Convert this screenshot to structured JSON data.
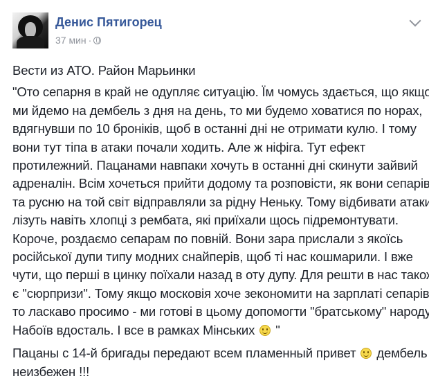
{
  "post": {
    "author": "Денис Пятигорец",
    "time": "37 мин",
    "separator": "·",
    "paragraphs": [
      {
        "lines": [
          "Вести из АТО. Район Марьинки"
        ]
      },
      {
        "lines": [
          "\"Ото сепарня в край не одупляє ситуацію. Їм чомусь здається, що якщо",
          "ми йдемо на дембель з дня на день, то ми будемо ховатися по норах,",
          "вдягнувши по 10 броніків, щоб в останні дні не отримати кулю. І тому",
          "вони тут тіпа в атаки почали ходить. Але ж ніфіга. Тут ефект",
          "протилежний. Пацанами навпаки хочуть в останні дні скинути зайвий",
          "адреналін. Всім хочеться прийти додому та розповісти, як вони сепарів",
          "та русню на той світ відправляли за рідну Неньку. Тому відбивати атаки",
          "лізуть навіть хлопці з рембата, які приїхали щось підремонтувати.",
          "Короче, роздаємо сепарам по повній. Вони зара прислали з якоїсь",
          "російської дупи типу модних снайперів, щоб ті нас кошмарили. І вже",
          "чути, що перші в цинку поїхали назад в оту дупу. Для решти в нас також",
          "є \"сюрпризи\". Тому якщо московія хоче зекономити на зарплаті сепарів,",
          "то ласкаво просимо - ми готові в цьому допомогти \"братському\" народу."
        ],
        "last_line_before": "Набоїв вдосталь. І все в рамках Мінських",
        "last_line_after": "\""
      },
      {
        "line1_before": "Пацаны с 14-й бригады передают всем пламенный привет",
        "line1_after": "дембель",
        "line2": "неизбежен !!!"
      }
    ]
  },
  "icons": {
    "emoji": "smiley-emoji-icon",
    "audience": "globe-icon",
    "options": "chevron-down-icon"
  },
  "colors": {
    "author_link": "#365899",
    "meta_text": "#90949c",
    "body_text": "#1d2129"
  }
}
